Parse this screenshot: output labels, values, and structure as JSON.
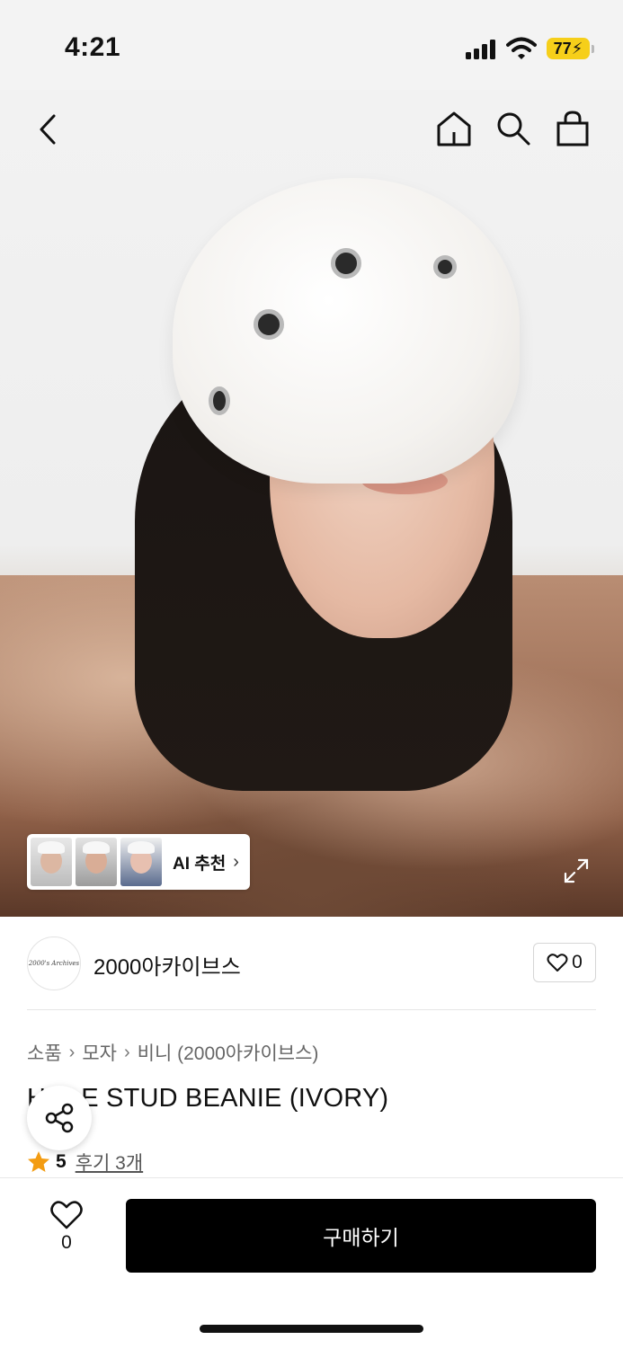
{
  "status": {
    "time": "4:21",
    "battery": "77"
  },
  "gallery": {
    "ai_label": "AI 추천"
  },
  "brand": {
    "name": "2000아카이브스",
    "logo_text": "2000's Archives",
    "likes": "0"
  },
  "breadcrumb": [
    "소품",
    "모자",
    "비니 (2000아카이브스)"
  ],
  "product": {
    "title": "HOLE STUD BEANIE (IVORY)",
    "rating": "5",
    "reviews": "후기 3개"
  },
  "bottom": {
    "wish_count": "0",
    "buy_label": "구매하기"
  },
  "colors": {
    "accent": "#000000",
    "star": "#f39c12",
    "battery": "#f6cf1a"
  },
  "icons": [
    "back-icon",
    "home-icon",
    "search-icon",
    "bag-icon",
    "expand-icon",
    "heart-icon",
    "share-icon",
    "star-icon",
    "chevron-right-icon"
  ]
}
